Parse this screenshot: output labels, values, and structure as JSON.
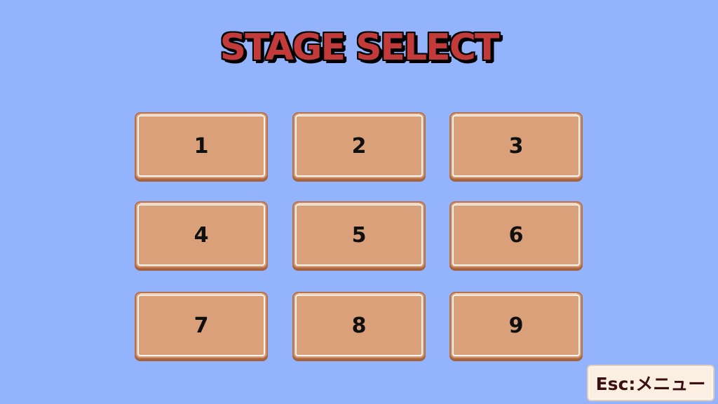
{
  "screen": {
    "title": "STAGE SELECT"
  },
  "stages": [
    {
      "label": "1"
    },
    {
      "label": "2"
    },
    {
      "label": "3"
    },
    {
      "label": "4"
    },
    {
      "label": "5"
    },
    {
      "label": "6"
    },
    {
      "label": "7"
    },
    {
      "label": "8"
    },
    {
      "label": "9"
    }
  ],
  "menu_hint": {
    "label": "Esc:メニュー"
  },
  "colors": {
    "background": "#93b4fd",
    "title_fill": "#c23a3a",
    "button_fill": "#d9a07a",
    "button_border": "#b87148",
    "hint_fill": "#fbeee2"
  }
}
